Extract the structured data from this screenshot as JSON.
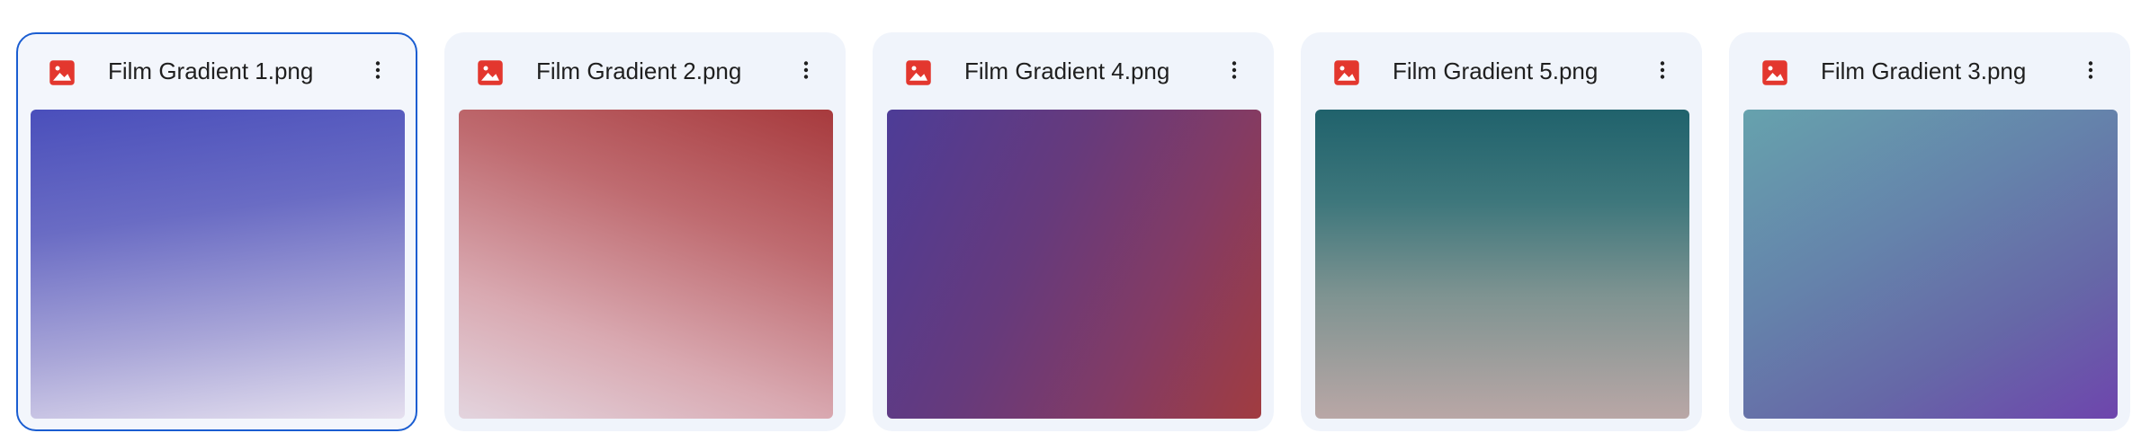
{
  "colors": {
    "accent_selected_border": "#1a5dd1",
    "card_background": "#f0f4fb",
    "image_icon": "#e3372e"
  },
  "files": [
    {
      "name": "Film Gradient 1.png",
      "icon": "image-file-icon",
      "selected": true
    },
    {
      "name": "Film Gradient 2.png",
      "icon": "image-file-icon",
      "selected": false
    },
    {
      "name": "Film Gradient 4.png",
      "icon": "image-file-icon",
      "selected": false
    },
    {
      "name": "Film Gradient 5.png",
      "icon": "image-file-icon",
      "selected": false
    },
    {
      "name": "Film Gradient 3.png",
      "icon": "image-file-icon",
      "selected": false
    }
  ],
  "more_actions_icon": "more-vert-icon"
}
